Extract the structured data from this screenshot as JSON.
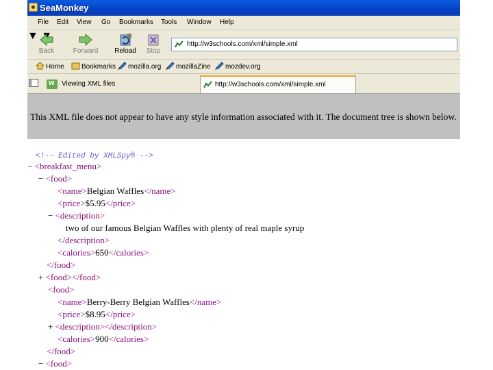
{
  "window": {
    "title": "SeaMonkey"
  },
  "menu": [
    "File",
    "Edit",
    "View",
    "Go",
    "Bookmarks",
    "Tools",
    "Window",
    "Help"
  ],
  "nav": {
    "back": "Back",
    "forward": "Forward",
    "reload": "Reload",
    "stop": "Stop",
    "url": "http://w3schools.com/xml/simple.xml"
  },
  "bookmarks": [
    "Home",
    "Bookmarks",
    "mozilla.org",
    "mozillaZine",
    "mozdev.org"
  ],
  "tabs": [
    {
      "label": "Viewing XML files"
    },
    {
      "label": "http://w3schools.com/xml/simple.xml"
    }
  ],
  "content": {
    "info": "This XML file does not appear to have any style information associated with it. The document tree is shown below.",
    "comment": "<!-- Edited by XMLSpy® -->",
    "minus": "−",
    "plus": "+",
    "tags": {
      "breakfast_open": "<breakfast_menu>",
      "food_open": "<food>",
      "food_close": "</food>",
      "name_open": "<name>",
      "name_close": "</name>",
      "price_open": "<price>",
      "price_close": "</price>",
      "description_open": "<description>",
      "description_close": "</description>",
      "calories_open": "<calories>",
      "calories_close": "</calories>"
    },
    "food1": {
      "name": "Belgian Waffles",
      "price": "$5.95",
      "description": "two of our famous Belgian Waffles with plenty of real maple syrup",
      "calories": "650"
    },
    "food3": {
      "name": "Berry-Berry Belgian Waffles",
      "price": "$8.95",
      "calories": "900"
    }
  },
  "colors": {
    "titlebar": "#0542c4",
    "tag": "#881280",
    "chrome": "#ece9d8",
    "infobar": "#c0c0c0"
  }
}
